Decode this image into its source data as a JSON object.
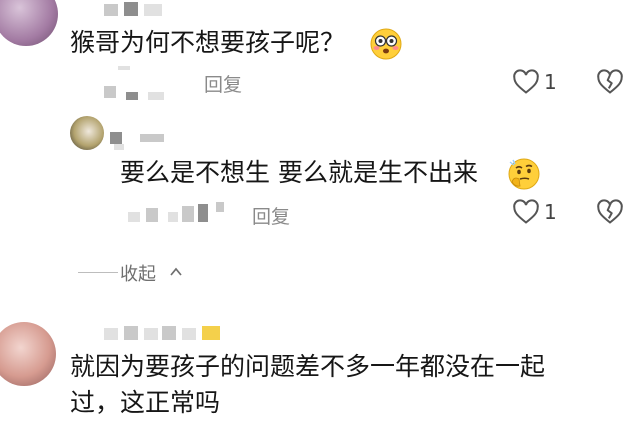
{
  "comments": [
    {
      "text": "猴哥为何不想要孩子呢？",
      "emoji": "flushed-face-emoji",
      "reply_label": "回复",
      "like_count": "1",
      "like_icon": "heart-outline-icon",
      "dislike_icon": "broken-heart-icon"
    },
    {
      "text": "要么是不想生 要么就是生不出来",
      "emoji": "thinking-face-emoji",
      "reply_label": "回复",
      "like_count": "1",
      "like_icon": "heart-outline-icon",
      "dislike_icon": "broken-heart-icon"
    },
    {
      "text_line1": "就因为要孩子的问题差不多一年都没在一起",
      "text_line2": "过，这正常吗"
    }
  ],
  "collapse": {
    "label": "收起",
    "icon": "chevron-up-icon"
  },
  "colors": {
    "text": "#161616",
    "meta": "#8a8a8a",
    "pixelated": "#c9c9c9"
  }
}
